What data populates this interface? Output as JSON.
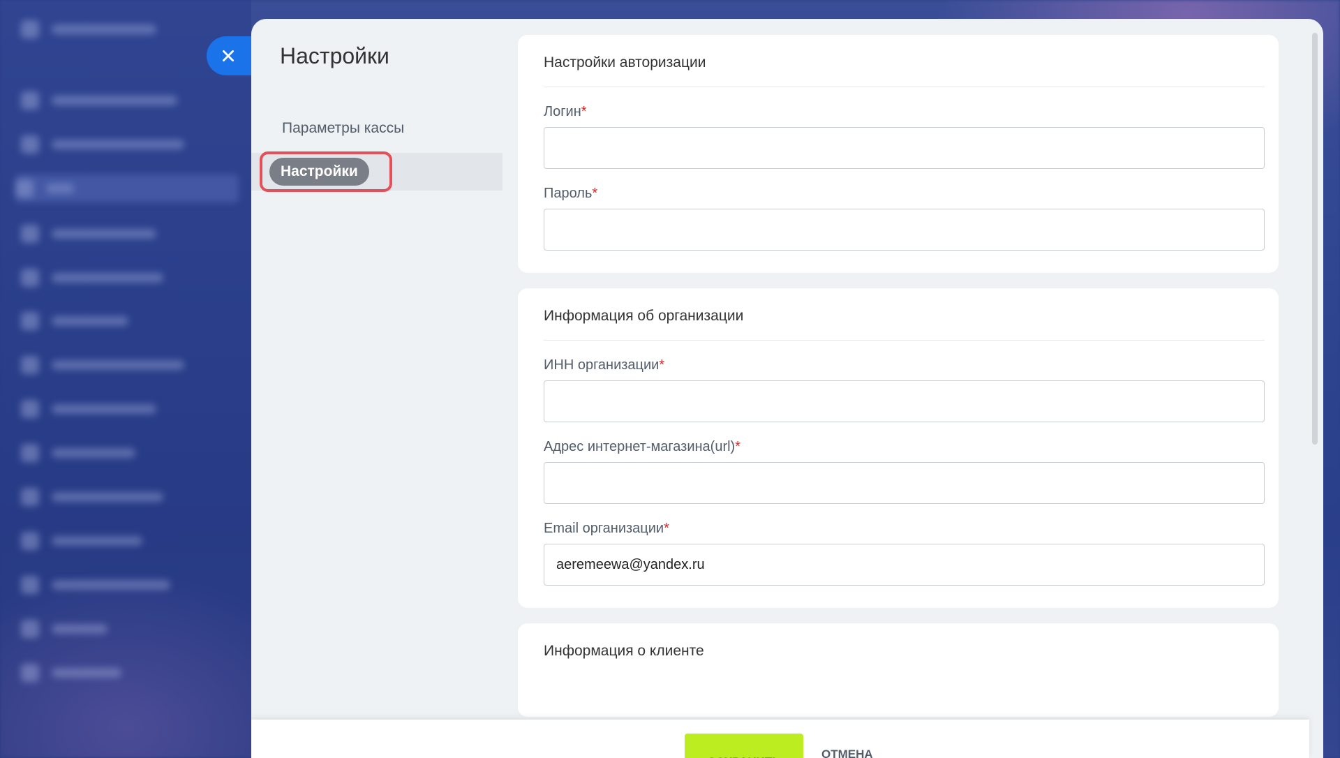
{
  "panel": {
    "title": "Настройки",
    "close_icon": "close-icon",
    "accent_color": "#1a73e8"
  },
  "side_nav": {
    "items": [
      {
        "label": "Параметры кассы",
        "active": false
      },
      {
        "label": "Настройки",
        "active": true
      }
    ],
    "highlight_color": "#e4505a"
  },
  "sections": {
    "auth": {
      "title": "Настройки авторизации",
      "login_label": "Логин",
      "login_value": "",
      "password_label": "Пароль",
      "password_value": ""
    },
    "org": {
      "title": "Информация об организации",
      "inn_label": "ИНН организации",
      "inn_value": "",
      "url_label": "Адрес интернет-магазина(url)",
      "url_value": "",
      "email_label": "Email организации",
      "email_value": "aeremeewa@yandex.ru"
    },
    "client": {
      "title": "Информация о клиенте"
    }
  },
  "required_mark": "*",
  "footer": {
    "save_label": "СОХРАНИТЬ",
    "cancel_label": "ОТМЕНА",
    "save_color": "#bbed21"
  }
}
